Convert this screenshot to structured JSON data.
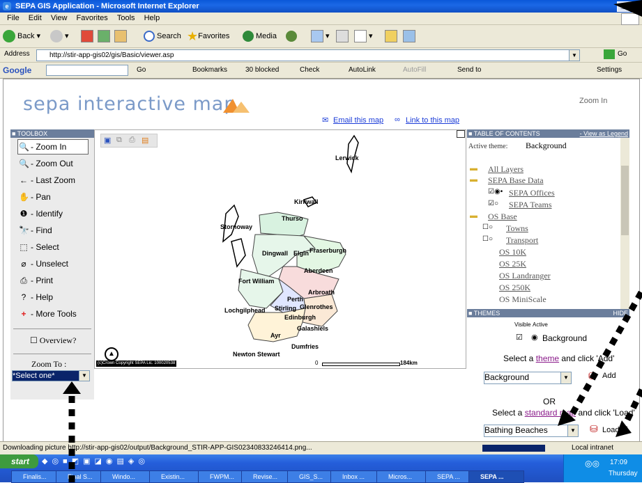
{
  "window": {
    "title": "SEPA GIS Application - Microsoft Internet Explorer"
  },
  "menu": [
    "File",
    "Edit",
    "View",
    "Favorites",
    "Tools",
    "Help"
  ],
  "toolbar": {
    "back": "Back",
    "search": "Search",
    "favorites": "Favorites",
    "media": "Media"
  },
  "address": {
    "label": "Address",
    "url": "http://stir-app-gis02/gis/Basic/viewer.asp",
    "go": "Go"
  },
  "google": {
    "label": "Google",
    "go": "Go",
    "bookmarks": "Bookmarks",
    "blocked": "30 blocked",
    "check": "Check",
    "autolink": "AutoLink",
    "autofill": "AutoFill",
    "sendto": "Send to",
    "settings": "Settings"
  },
  "page": {
    "logo": "sepa interactive map",
    "mode_label": "Zoom In",
    "email_link": "Email this map",
    "link_to_map": "Link to this map"
  },
  "toolbox": {
    "header": "TOOLBOX",
    "tools": [
      "- Zoom In",
      "- Zoom Out",
      "- Last Zoom",
      "- Pan",
      "- Identify",
      "- Find",
      "- Select",
      "- Unselect",
      "- Print",
      "- Help",
      "- More Tools"
    ],
    "overview": "Overview?",
    "zoom_to": "Zoom To :",
    "zoom_select": "*Select one*"
  },
  "map": {
    "places": [
      "Lerwick",
      "Kirkwall",
      "Stornoway",
      "Thurso",
      "Dingwall",
      "Elgin",
      "Fraserburgh",
      "Aberdeen",
      "Fort William",
      "Arbroath",
      "Perth",
      "Lochgilphead",
      "Stirling",
      "Glenrothes",
      "Edinburgh",
      "Galashiels",
      "Ayr",
      "Dumfries",
      "Newton Stewart"
    ],
    "copyright": "(c)Crown Copyright  SEPA Lic. 100020538",
    "scale_start": "0",
    "scale_end": "184km"
  },
  "toc": {
    "header": "TABLE OF CONTENTS",
    "view_legend": "- View as Legend",
    "active_label": "Active theme:",
    "active_value": "Background",
    "layers": [
      "All Layers",
      "SEPA Base Data",
      "SEPA Offices",
      "SEPA Teams",
      "OS Base",
      "Towns",
      "Transport",
      "OS 10K",
      "OS 25K",
      "OS Landranger",
      "OS 250K",
      "OS MiniScale"
    ]
  },
  "themes": {
    "header": "THEMES",
    "hide": "HIDE",
    "col_visible": "Visible",
    "col_active": "Active",
    "row_label": "Background",
    "select_text_1": "Select a",
    "theme_link": "theme",
    "select_text_2": "and click 'Add'",
    "theme_select": "Background",
    "add": "Add",
    "or": "OR",
    "select_text_3": "Select a",
    "map_link": "standard map",
    "select_text_4": "and click 'Load'",
    "map_select": "Bathing Beaches",
    "load": "Load"
  },
  "status": {
    "text": "Downloading picture http://stir-app-gis02/output/Background_STIR-APP-GIS02340833246414.png...",
    "zone": "Local intranet"
  },
  "taskbar": {
    "start": "start",
    "tasks": [
      "Finalis...",
      "Final S...",
      "Windo...",
      "Existin...",
      "FWPM...",
      "Revise...",
      "GIS_S...",
      "Inbox ...",
      "Micros...",
      "SEPA ...",
      "SEPA ..."
    ],
    "time": "17:09",
    "day": "Thursday"
  }
}
